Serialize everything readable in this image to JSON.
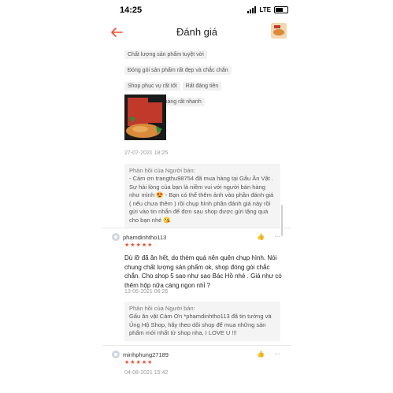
{
  "status": {
    "time": "14:25",
    "network": "LTE"
  },
  "header": {
    "title": "Đánh giá",
    "back_icon": "arrow-left-icon",
    "accent": "#ee4d2d"
  },
  "review1": {
    "tags": [
      "Chất lượng sản phẩm tuyệt vời",
      "Đóng gói sản phẩm rất đẹp và chắc chắn",
      "Shop phục vụ rất tốt",
      "Rất đáng tiền",
      "Thời gian giao hàng rất nhanh"
    ],
    "image_caption": "Gấu Ăn Vặt",
    "date": "27-07-2021 18:25",
    "reply_title": "Phản hồi của Người bán:",
    "reply_body": "- Cảm ơn trangthu98754 đã mua hàng tại Gấu Ăn Vặt . Sự hài lòng của bạn là niềm vui với người bán hàng như mình 😍 - Bạn có thể thêm ảnh vào phần đánh giá ( nếu chưa thêm ) rồi chụp hình phần đánh giá này rồi gửi vào tin nhắn để đơn sau shop được gửi tặng quà cho bạn nhé 😘"
  },
  "review2": {
    "username": "phamdinhtho113",
    "rating": 5,
    "text": "Dù lỡ đã ăn hết, do thèm quá nên quên chụp hình. Nói chung chất lượng sản phẩm ok, shop đóng gói chắc chắn. Cho shop 5 sao như sao Bác Hồ nhé . Giá như có thêm hộp nữa càng ngon nhỉ ?",
    "date": "13-06-2021 06:26",
    "reply_title": "Phản hồi của Người bán:",
    "reply_body": "Gấu ăn vặt Cảm Ơn *phamdinhtho113 đã tin tưởng và Ủng Hộ Shop, hãy theo dõi shop để mua những sản phẩm mới nhất từ shop nha, I LOVE U !!!"
  },
  "review3": {
    "username": "minhphung27189",
    "rating": 5,
    "date": "04-08-2021 15:42"
  }
}
